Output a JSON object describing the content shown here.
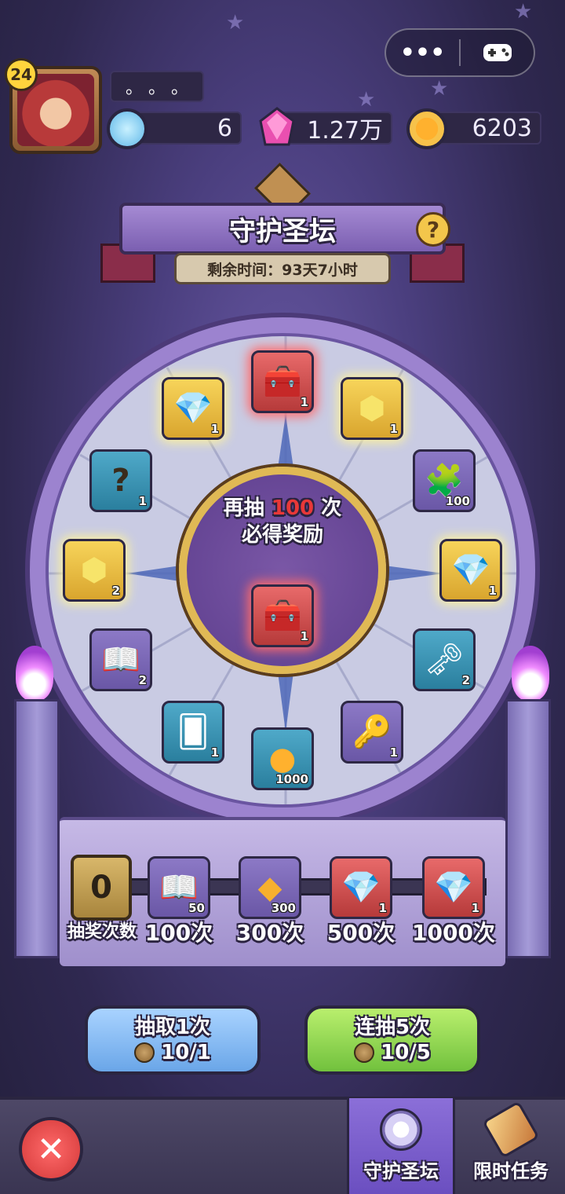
{
  "header": {
    "more_icon": "more-dots-icon",
    "gamepad_icon": "gamepad-icon",
    "player_level": "24",
    "player_name": "。。。",
    "currencies": [
      {
        "name": "diamond",
        "value": "6",
        "color": "#7fd3f5"
      },
      {
        "name": "gem",
        "value": "1.27万",
        "color": "#e94fb0"
      },
      {
        "name": "coin",
        "value": "6203",
        "color": "#f0a020"
      }
    ]
  },
  "event": {
    "title": "守护圣坛",
    "help_label": "?",
    "remaining_time": "剩余时间：93天7小时"
  },
  "wheel": {
    "center_line1_prefix": "再抽",
    "center_line1_number": "100",
    "center_line1_suffix": "次",
    "center_line2": "必得奖励",
    "center_prize_count": "1",
    "prizes": [
      {
        "name": "treasure-chest",
        "count": "1",
        "glyph": "🧰"
      },
      {
        "name": "gold-hex-gem",
        "count": "1",
        "glyph": "⬢"
      },
      {
        "name": "puzzle-piece",
        "count": "100",
        "glyph": "🧩"
      },
      {
        "name": "mystery-gem-bag",
        "count": "1",
        "glyph": "💎"
      },
      {
        "name": "silver-key",
        "count": "2",
        "glyph": "🗝"
      },
      {
        "name": "gold-key",
        "count": "1",
        "glyph": "🔑"
      },
      {
        "name": "gold-coin",
        "count": "1000",
        "glyph": "●"
      },
      {
        "name": "card-pack",
        "count": "1",
        "glyph": "🂠"
      },
      {
        "name": "magic-book",
        "count": "2",
        "glyph": "📖"
      },
      {
        "name": "gold-hex-gem",
        "count": "2",
        "glyph": "⬢"
      },
      {
        "name": "mystery-banner",
        "count": "1",
        "glyph": "?"
      },
      {
        "name": "mystery-gem-bag",
        "count": "1",
        "glyph": "💎"
      }
    ]
  },
  "milestones": {
    "draw_count": "0",
    "draw_count_label": "抽奖次数",
    "items": [
      {
        "name": "magic-book",
        "count": "50",
        "label": "100次",
        "glyph": "📖"
      },
      {
        "name": "amber-crystal",
        "count": "300",
        "label": "300次",
        "glyph": "◆"
      },
      {
        "name": "mystery-gem-bag",
        "count": "1",
        "label": "500次",
        "glyph": "💎"
      },
      {
        "name": "mystery-gem-bag",
        "count": "1",
        "label": "1000次",
        "glyph": "💎"
      }
    ]
  },
  "actions": {
    "draw_one_label": "抽取1次",
    "draw_one_cost": "10/1",
    "draw_five_label": "连抽5次",
    "draw_five_cost": "10/5"
  },
  "bottom_nav": {
    "close_label": "✕",
    "tabs": [
      {
        "label": "守护圣坛",
        "active": true
      },
      {
        "label": "限时任务",
        "active": false
      }
    ]
  }
}
